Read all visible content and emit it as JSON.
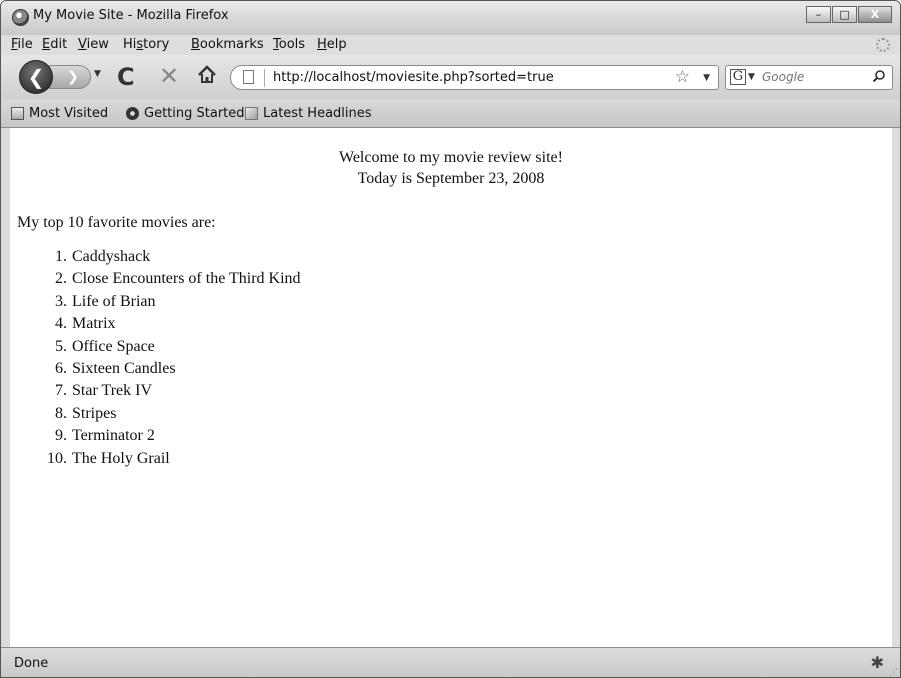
{
  "window": {
    "title": "My Movie Site - Mozilla Firefox",
    "controls": {
      "minimize": "–",
      "maximize": "□",
      "close": "X"
    }
  },
  "menu": [
    {
      "accel": "F",
      "rest": "ile"
    },
    {
      "accel": "E",
      "rest": "dit"
    },
    {
      "accel": "V",
      "rest": "iew"
    },
    {
      "accel": "",
      "pre": "Hi",
      "accel2": "s",
      "rest": "tory"
    },
    {
      "accel": "B",
      "rest": "ookmarks"
    },
    {
      "accel": "T",
      "rest": "ools"
    },
    {
      "accel": "H",
      "rest": "elp"
    }
  ],
  "navigation": {
    "url": "http://localhost/moviesite.php?sorted=true",
    "search_placeholder": "Google",
    "search_engine_letter": "G"
  },
  "bookmarks": [
    {
      "label": "Most Visited",
      "icon": "folder-icon"
    },
    {
      "label": "Getting Started",
      "icon": "gear-icon"
    },
    {
      "label": "Latest Headlines",
      "icon": "rss-icon"
    }
  ],
  "page": {
    "welcome_line": "Welcome to my movie review site!",
    "date_line": "Today is September 23, 2008",
    "intro": "My top 10 favorite movies are:",
    "movies": [
      {
        "number": "1.",
        "title": "Caddyshack"
      },
      {
        "number": "2.",
        "title": "Close Encounters of the Third Kind"
      },
      {
        "number": "3.",
        "title": "Life of Brian"
      },
      {
        "number": "4.",
        "title": "Matrix"
      },
      {
        "number": "5.",
        "title": "Office Space"
      },
      {
        "number": "6.",
        "title": "Sixteen Candles"
      },
      {
        "number": "7.",
        "title": "Star Trek IV"
      },
      {
        "number": "8.",
        "title": "Stripes"
      },
      {
        "number": "9.",
        "title": "Terminator 2"
      },
      {
        "number": "10.",
        "title": "The Holy Grail"
      }
    ]
  },
  "status": {
    "text": "Done"
  }
}
